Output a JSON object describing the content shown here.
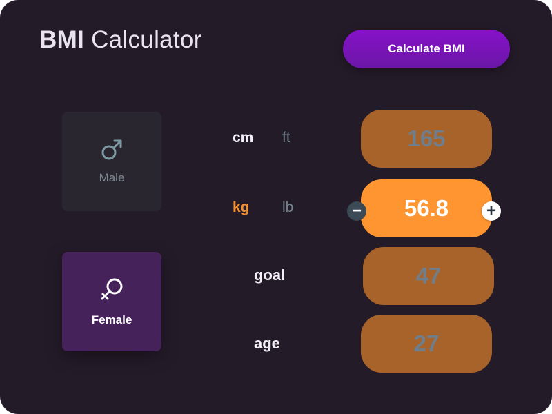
{
  "header": {
    "title_bold": "BMI",
    "title_rest": " Calculator",
    "calculate_label": "Calculate BMI"
  },
  "gender": {
    "male": {
      "label": "Male",
      "icon": "male-symbol-icon",
      "selected": false
    },
    "female": {
      "label": "Female",
      "icon": "female-symbol-icon",
      "selected": true
    }
  },
  "height": {
    "units": [
      "cm",
      "ft"
    ],
    "selected_unit": "cm",
    "value": "165"
  },
  "weight": {
    "units": [
      "kg",
      "lb"
    ],
    "selected_unit": "kg",
    "value": "56.8",
    "minus_symbol": "−",
    "plus_symbol": "+"
  },
  "goal": {
    "label": "goal",
    "value": "47"
  },
  "age": {
    "label": "age",
    "value": "27"
  },
  "colors": {
    "background": "#241b28",
    "accent_purple": "#8712c9",
    "accent_orange": "#ff9531",
    "pill_inactive": "#a8632a",
    "female_card": "#46225a",
    "male_card": "#2a2630"
  }
}
